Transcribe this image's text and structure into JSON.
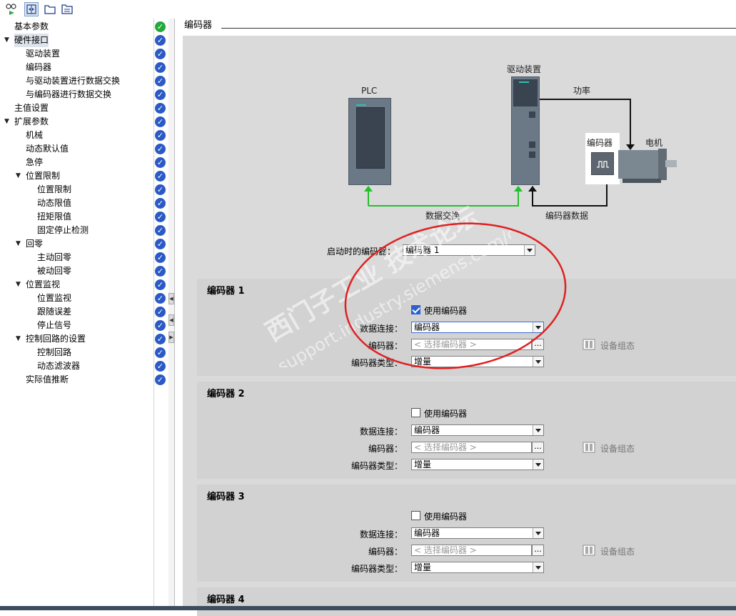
{
  "tree": {
    "items": [
      {
        "label": "基本参数",
        "level": 0,
        "arrow": "",
        "status": "green",
        "selected": false
      },
      {
        "label": "硬件接口",
        "level": 0,
        "arrow": "▼",
        "status": "blue",
        "selected": true
      },
      {
        "label": "驱动装置",
        "level": 1,
        "arrow": "",
        "status": "blue",
        "selected": false
      },
      {
        "label": "编码器",
        "level": 1,
        "arrow": "",
        "status": "blue",
        "selected": false
      },
      {
        "label": "与驱动装置进行数据交换",
        "level": 1,
        "arrow": "",
        "status": "blue",
        "selected": false
      },
      {
        "label": "与编码器进行数据交换",
        "level": 1,
        "arrow": "",
        "status": "blue",
        "selected": false
      },
      {
        "label": "主值设置",
        "level": 0,
        "arrow": "",
        "status": "blue",
        "selected": false
      },
      {
        "label": "扩展参数",
        "level": 0,
        "arrow": "▼",
        "status": "blue",
        "selected": false
      },
      {
        "label": "机械",
        "level": 1,
        "arrow": "",
        "status": "blue",
        "selected": false
      },
      {
        "label": "动态默认值",
        "level": 1,
        "arrow": "",
        "status": "blue",
        "selected": false
      },
      {
        "label": "急停",
        "level": 1,
        "arrow": "",
        "status": "blue",
        "selected": false
      },
      {
        "label": "位置限制",
        "level": 1,
        "arrow": "▼",
        "status": "blue",
        "selected": false
      },
      {
        "label": "位置限制",
        "level": 2,
        "arrow": "",
        "status": "blue",
        "selected": false
      },
      {
        "label": "动态限值",
        "level": 2,
        "arrow": "",
        "status": "blue",
        "selected": false
      },
      {
        "label": "扭矩限值",
        "level": 2,
        "arrow": "",
        "status": "blue",
        "selected": false
      },
      {
        "label": "固定停止检测",
        "level": 2,
        "arrow": "",
        "status": "blue",
        "selected": false
      },
      {
        "label": "回零",
        "level": 1,
        "arrow": "▼",
        "status": "blue",
        "selected": false
      },
      {
        "label": "主动回零",
        "level": 2,
        "arrow": "",
        "status": "blue",
        "selected": false
      },
      {
        "label": "被动回零",
        "level": 2,
        "arrow": "",
        "status": "blue",
        "selected": false
      },
      {
        "label": "位置监视",
        "level": 1,
        "arrow": "▼",
        "status": "blue",
        "selected": false
      },
      {
        "label": "位置监视",
        "level": 2,
        "arrow": "",
        "status": "blue",
        "selected": false
      },
      {
        "label": "跟随误差",
        "level": 2,
        "arrow": "",
        "status": "blue",
        "selected": false
      },
      {
        "label": "停止信号",
        "level": 2,
        "arrow": "",
        "status": "blue",
        "selected": false
      },
      {
        "label": "控制回路的设置",
        "level": 1,
        "arrow": "▼",
        "status": "blue",
        "selected": false
      },
      {
        "label": "控制回路",
        "level": 2,
        "arrow": "",
        "status": "blue",
        "selected": false
      },
      {
        "label": "动态滤波器",
        "level": 2,
        "arrow": "",
        "status": "blue",
        "selected": false
      },
      {
        "label": "实际值推断",
        "level": 1,
        "arrow": "",
        "status": "blue",
        "selected": false
      }
    ]
  },
  "main": {
    "title": "编码器",
    "diagram": {
      "plc": "PLC",
      "drive": "驱动装置",
      "power": "功率",
      "encoder": "编码器",
      "motor": "电机",
      "data_exchange": "数据交换",
      "encoder_data": "编码器数据"
    },
    "startup_label": "启动时的编码器：",
    "startup_value": "编码器 1",
    "sections": [
      {
        "title": "编码器 1",
        "use_label": "使用编码器",
        "checked": true,
        "conn_label": "数据连接：",
        "conn_value": "编码器",
        "enc_label": "编码器：",
        "enc_placeholder": "< 选择编码器 >",
        "type_label": "编码器类型：",
        "type_value": "增量",
        "device_config": "设备组态"
      },
      {
        "title": "编码器 2",
        "use_label": "使用编码器",
        "checked": false,
        "conn_label": "数据连接：",
        "conn_value": "编码器",
        "enc_label": "编码器：",
        "enc_placeholder": "< 选择编码器 >",
        "type_label": "编码器类型：",
        "type_value": "增量",
        "device_config": "设备组态"
      },
      {
        "title": "编码器 3",
        "use_label": "使用编码器",
        "checked": false,
        "conn_label": "数据连接：",
        "conn_value": "编码器",
        "enc_label": "编码器：",
        "enc_placeholder": "< 选择编码器 >",
        "type_label": "编码器类型：",
        "type_value": "增量",
        "device_config": "设备组态"
      },
      {
        "title": "编码器 4"
      }
    ]
  },
  "watermark": {
    "line1": "西门子工业 技术论坛",
    "line2": "support.industry.siemens.com/cs"
  },
  "colors": {
    "status_blue": "#2b5ac6",
    "status_green": "#24a83a",
    "annotation_red": "#e02020",
    "link_green": "#22c02a"
  }
}
